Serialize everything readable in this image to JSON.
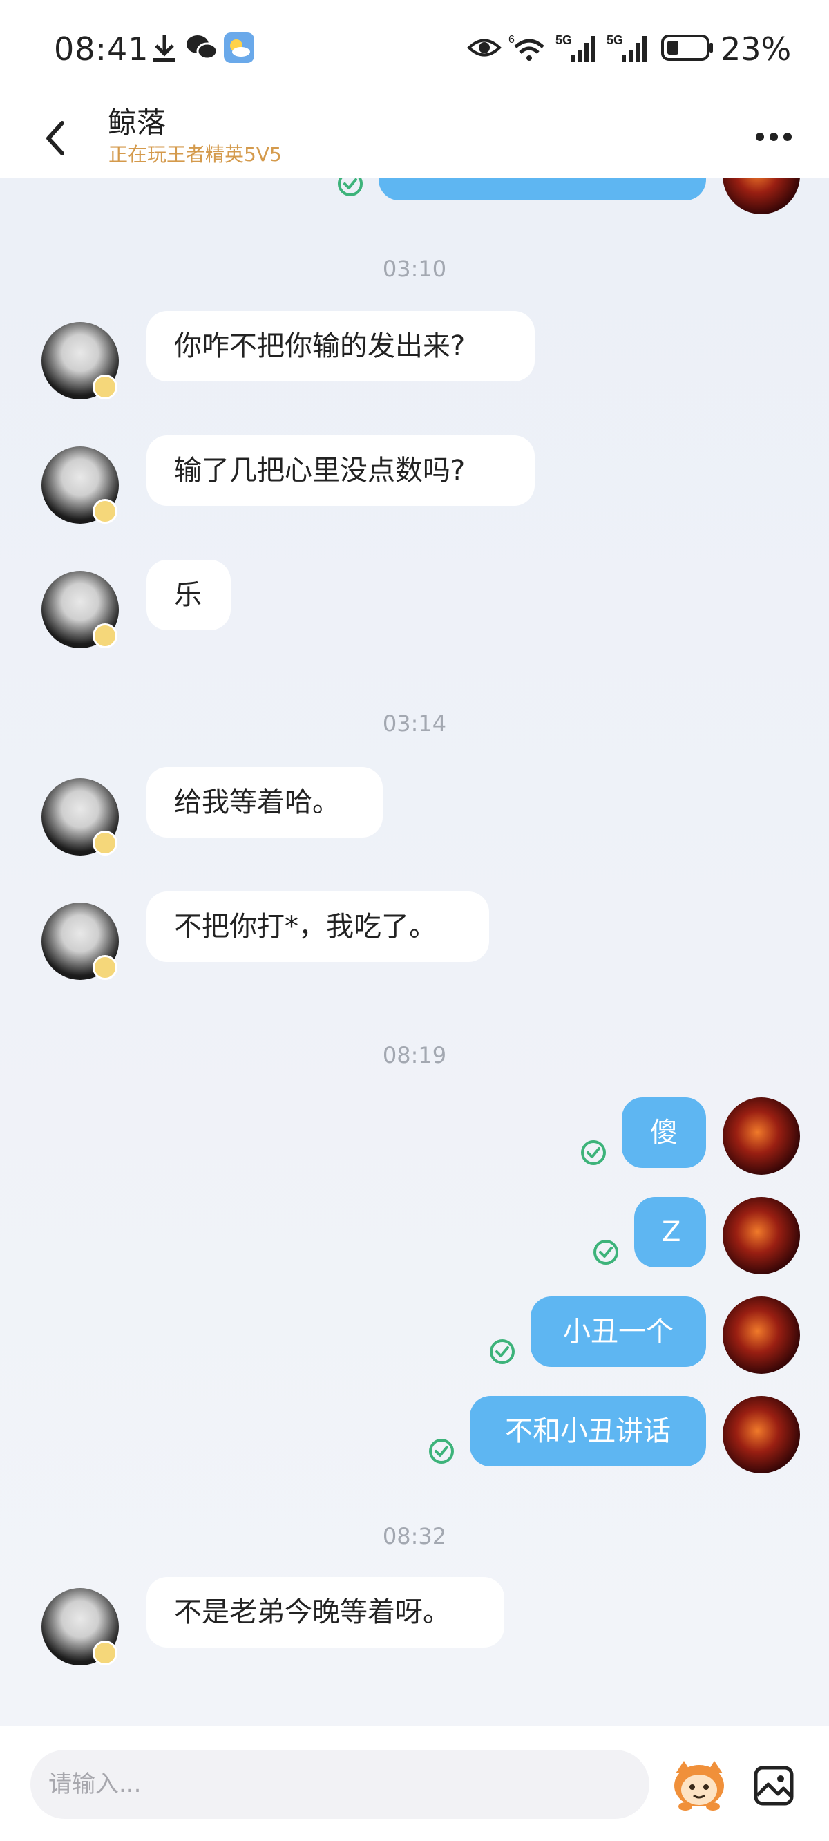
{
  "status_bar": {
    "time": "08:41",
    "battery": "23%",
    "icons": [
      "download-icon",
      "wechat-icon",
      "weather-icon",
      "eye-icon",
      "wifi-icon",
      "signal-5g-icon",
      "signal-5g-icon",
      "battery-icon"
    ]
  },
  "header": {
    "name": "鲸落",
    "status": "正在玩王者精英5V5",
    "icons": [
      "back-icon",
      "more-icon"
    ]
  },
  "messages": {
    "ts_1": "03:10",
    "in_1": "你咋不把你输的发出来?",
    "in_2": "输了几把心里没点数吗?",
    "in_3": "乐",
    "ts_2": "03:14",
    "in_4": "给我等着哈。",
    "in_5": "不把你打*，我吃了。",
    "ts_3": "08:19",
    "out_1": "傻",
    "out_2": "Z",
    "out_3": "小丑一个",
    "out_4": "不和小丑讲话",
    "ts_4": "08:32",
    "in_6": "不是老弟今晚等着呀。"
  },
  "input_bar": {
    "placeholder": "请输入...",
    "icons": [
      "emoji-mascot-icon",
      "image-icon"
    ]
  },
  "colors": {
    "outgoing_bubble": "#5eb6f2",
    "incoming_bubble": "#ffffff",
    "status_text": "#d49a4c",
    "read_check": "#3db37a"
  }
}
